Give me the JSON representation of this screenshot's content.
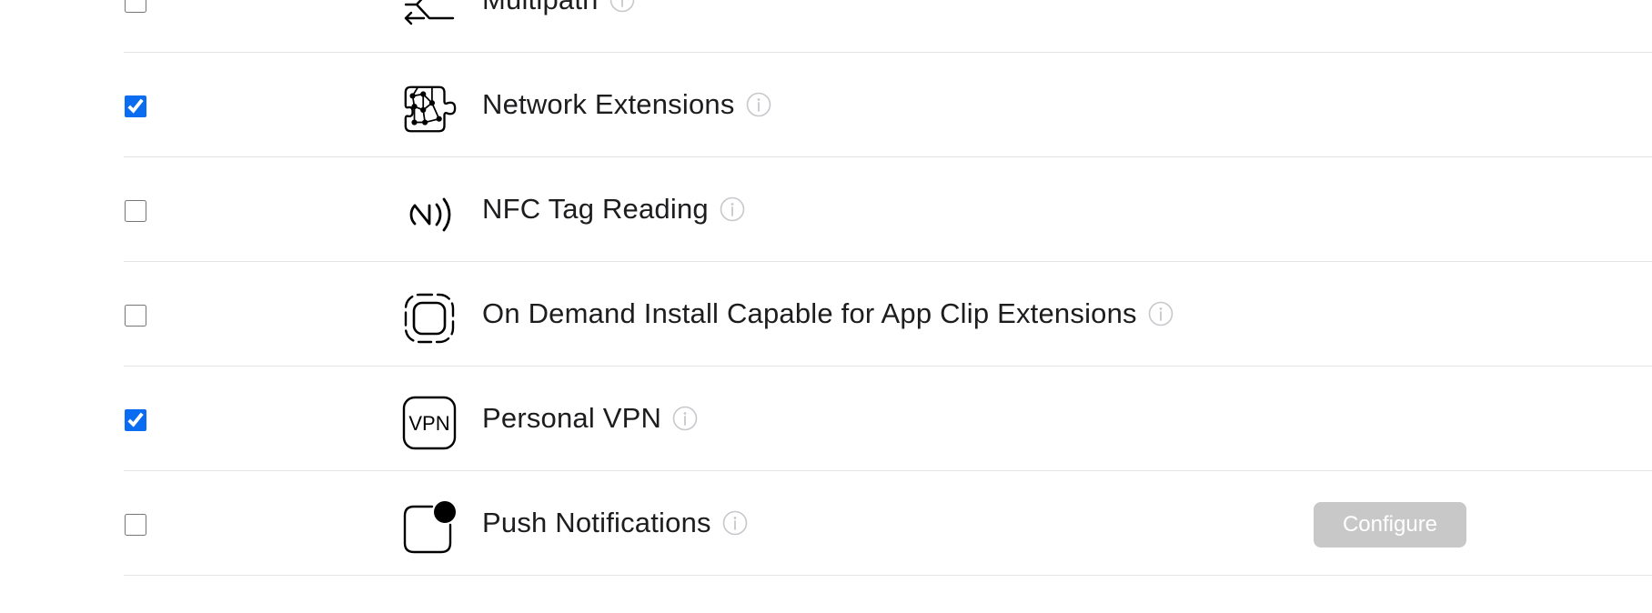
{
  "capabilities": [
    {
      "label": "Multipath",
      "checked": false,
      "icon": "multipath-icon"
    },
    {
      "label": "Network Extensions",
      "checked": true,
      "icon": "network-extensions-icon"
    },
    {
      "label": "NFC Tag Reading",
      "checked": false,
      "icon": "nfc-icon"
    },
    {
      "label": "On Demand Install Capable for App Clip Extensions",
      "checked": false,
      "icon": "app-clip-icon"
    },
    {
      "label": "Personal VPN",
      "checked": true,
      "icon": "vpn-icon",
      "icon_text": "VPN"
    },
    {
      "label": "Push Notifications",
      "checked": false,
      "icon": "push-notifications-icon",
      "action_label": "Configure",
      "action_enabled": false
    }
  ],
  "colors": {
    "checkbox_accent": "#0a6cf0",
    "divider": "#e4e4e6",
    "info_icon": "#c7c7cc",
    "configure_bg_disabled": "#c8c8c8",
    "text": "#1d1d1f"
  }
}
